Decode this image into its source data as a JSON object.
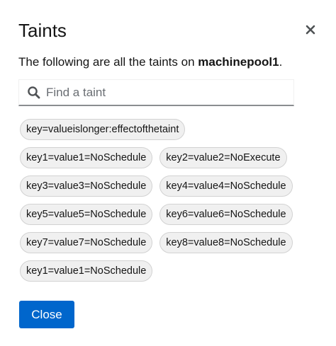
{
  "modal": {
    "title": "Taints",
    "description_prefix": "The following are all the taints on ",
    "description_bold": "machinepool1",
    "description_suffix": "."
  },
  "search": {
    "placeholder": "Find a taint",
    "value": ""
  },
  "chips": [
    [
      "key=valueislonger:effectofthetaint"
    ],
    [
      "key1=value1=NoSchedule",
      "key2=value2=NoExecute"
    ],
    [
      "key3=value3=NoSchedule",
      "key4=value4=NoSchedule"
    ],
    [
      "key5=value5=NoSchedule",
      "key6=value6=NoSchedule"
    ],
    [
      "key7=value7=NoSchedule",
      "key8=value8=NoSchedule"
    ],
    [
      "key1=value1=NoSchedule"
    ]
  ],
  "footer": {
    "close_label": "Close"
  },
  "colors": {
    "primary": "#0066cc",
    "chip_bg": "#f0f0f0",
    "chip_border": "#d2d2d2",
    "text": "#151515",
    "placeholder": "#6a6e73"
  },
  "icons": {
    "close": "close-icon",
    "search": "search-icon"
  }
}
